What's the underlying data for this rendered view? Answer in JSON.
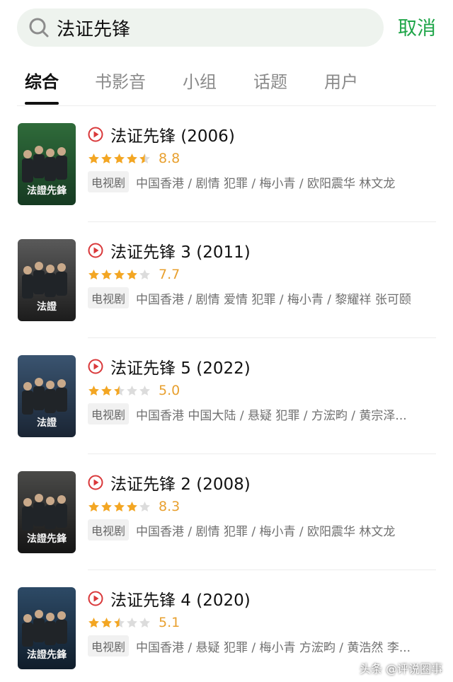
{
  "search": {
    "value": "法证先锋",
    "cancel_label": "取消"
  },
  "tabs": [
    {
      "label": "综合",
      "active": true
    },
    {
      "label": "书影音",
      "active": false
    },
    {
      "label": "小组",
      "active": false
    },
    {
      "label": "话题",
      "active": false
    },
    {
      "label": "用户",
      "active": false
    }
  ],
  "results": [
    {
      "title": "法证先锋 (2006)",
      "stars": 4.5,
      "rating": "8.8",
      "badge": "电视剧",
      "meta": "中国香港 / 剧情 犯罪 / 梅小青 / 欧阳震华 林文龙",
      "poster_colors": [
        "#2f6b3a",
        "#163a22"
      ]
    },
    {
      "title": "法证先锋 3 (2011)",
      "stars": 4,
      "rating": "7.7",
      "badge": "电视剧",
      "meta": "中国香港 / 剧情 爱情 犯罪 / 梅小青 / 黎耀祥 张可颐",
      "poster_colors": [
        "#5a5a5a",
        "#1c1c1c"
      ]
    },
    {
      "title": "法证先锋 5 (2022)",
      "stars": 2.5,
      "rating": "5.0",
      "badge": "电视剧",
      "meta": "中国香港 中国大陆 / 悬疑 犯罪 / 方浤畇 / 黄宗泽...",
      "poster_colors": [
        "#3a5470",
        "#1a2534"
      ]
    },
    {
      "title": "法证先锋 2 (2008)",
      "stars": 4,
      "rating": "8.3",
      "badge": "电视剧",
      "meta": "中国香港 / 剧情 犯罪 / 梅小青 / 欧阳震华 林文龙",
      "poster_colors": [
        "#4a4a48",
        "#151515"
      ]
    },
    {
      "title": "法证先锋 4 (2020)",
      "stars": 2.5,
      "rating": "5.1",
      "badge": "电视剧",
      "meta": "中国香港 / 悬疑 犯罪 / 梅小青 方浤畇 / 黄浩然 李...",
      "poster_colors": [
        "#2d4a66",
        "#101d2b"
      ]
    }
  ],
  "poster_texts": [
    "法證先鋒",
    "法證",
    "法證",
    "法證先鋒",
    "法證先鋒"
  ],
  "watermark": "头条 @评说圈事",
  "colors": {
    "accent_green": "#1ea548",
    "rating_orange": "#e8a02f",
    "play_red": "#d9383a"
  }
}
